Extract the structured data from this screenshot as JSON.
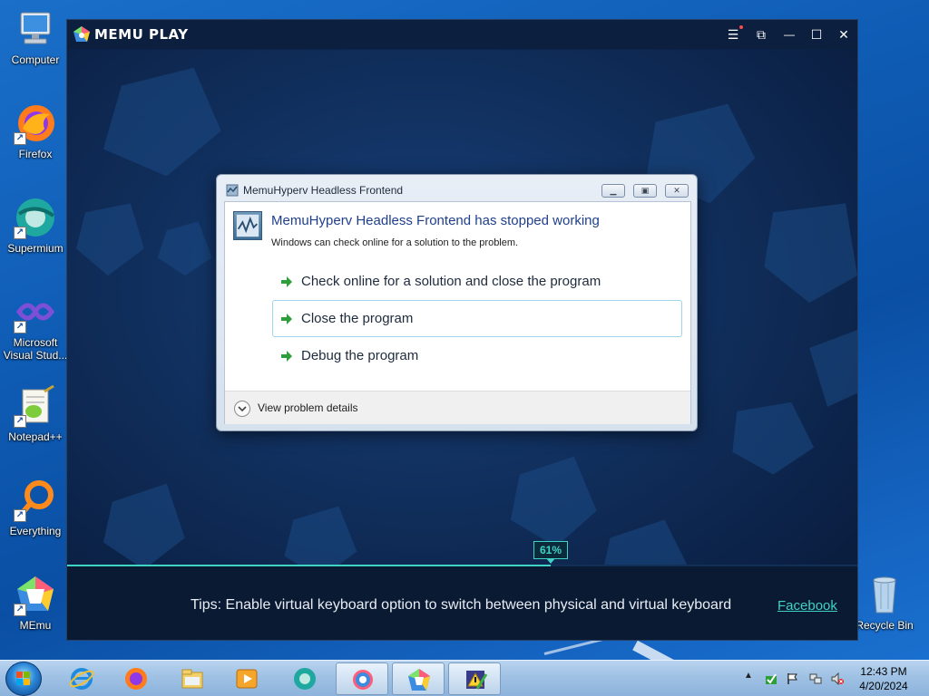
{
  "desktop": {
    "icons": [
      {
        "label": "Computer"
      },
      {
        "label": "Firefox"
      },
      {
        "label": "Supermium"
      },
      {
        "label": "Microsoft Visual Stud..."
      },
      {
        "label": "Notepad++"
      },
      {
        "label": "Everything"
      },
      {
        "label": "MEmu"
      },
      {
        "label": "Recycle Bin"
      }
    ]
  },
  "memu": {
    "logo_text": "MEMU PLAY",
    "controls": {
      "menu": "☰",
      "restore_win": "⧉",
      "minimize": "—",
      "maximize": "☐",
      "close": "✕"
    },
    "progress": {
      "percent_label": "61%",
      "value": 0.61
    },
    "tips_text": "Tips: Enable virtual keyboard option to switch between physical and virtual keyboard",
    "tips_link": "Facebook"
  },
  "dialog": {
    "title": "MemuHyperv Headless Frontend",
    "heading": "MemuHyperv Headless Frontend has stopped working",
    "subtext": "Windows can check online for a solution to the problem.",
    "options": [
      {
        "label": "Check online for a solution and close the program"
      },
      {
        "label": "Close the program"
      },
      {
        "label": "Debug the program"
      }
    ],
    "details_label": "View problem details"
  },
  "taskbar": {
    "clock_time": "12:43 PM",
    "clock_date": "4/20/2024"
  },
  "colors": {
    "accent": "#3fd3c4",
    "dialog_heading": "#1f3f8c",
    "memu_bg": "#0b2147"
  }
}
